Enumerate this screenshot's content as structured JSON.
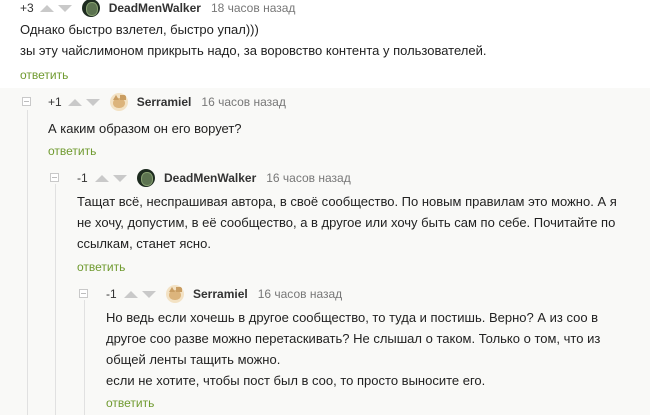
{
  "comments": [
    {
      "rating": "+3",
      "username": "DeadMenWalker",
      "time": "18 часов назад",
      "lines": [
        "Однако быстро взлетел, быстро упал)))",
        "зы эту чайслимоном прикрыть надо, за воровство контента у пользователей."
      ],
      "reply": "ответить"
    },
    {
      "rating": "+1",
      "username": "Serramiel",
      "time": "16 часов назад",
      "lines": [
        "А каким образом он его ворует?"
      ],
      "reply": "ответить"
    },
    {
      "rating": "-1",
      "username": "DeadMenWalker",
      "time": "16 часов назад",
      "lines": [
        "Тащат всё, неспрашивая автора, в своё сообщество. По новым правилам это можно. А я",
        "не хочу, допустим, в её сообщество, а в другое или хочу быть сам по себе. Почитайте по",
        "ссылкам, станет ясно."
      ],
      "reply": "ответить"
    },
    {
      "rating": "-1",
      "username": "Serramiel",
      "time": "16 часов назад",
      "lines": [
        "Но ведь если хочешь в другое сообщество, то туда и постишь. Верно? А из соо в",
        "другое соо разве можно перетаскивать? Не слышал о таком. Только о том, что из",
        "общей ленты тащить можно.",
        "если не хотите, чтобы пост был в соо, то просто выносите его."
      ],
      "reply": "ответить"
    }
  ]
}
